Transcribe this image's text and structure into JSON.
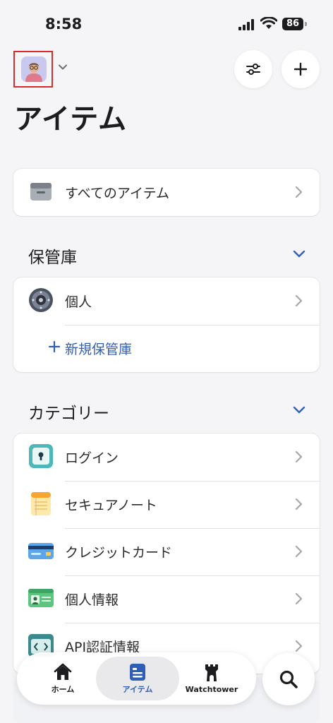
{
  "status_bar": {
    "time": "8:58",
    "battery": "86"
  },
  "header": {
    "title": "アイテム"
  },
  "all_items": {
    "label": "すべてのアイテム"
  },
  "vaults": {
    "section_title": "保管庫",
    "items": [
      {
        "label": "個人"
      }
    ],
    "add_label": "新規保管庫"
  },
  "categories": {
    "section_title": "カテゴリー",
    "items": [
      {
        "label": "ログイン",
        "icon": "login-icon"
      },
      {
        "label": "セキュアノート",
        "icon": "secure-note-icon"
      },
      {
        "label": "クレジットカード",
        "icon": "credit-card-icon"
      },
      {
        "label": "個人情報",
        "icon": "identity-icon"
      },
      {
        "label": "API認証情報",
        "icon": "api-credential-icon"
      }
    ]
  },
  "tabs": [
    {
      "label": "ホーム"
    },
    {
      "label": "アイテム"
    },
    {
      "label": "Watchtower"
    }
  ],
  "colors": {
    "accent": "#2f5fb4",
    "background": "#f5f5f7",
    "highlight_border": "#d82c2c"
  }
}
